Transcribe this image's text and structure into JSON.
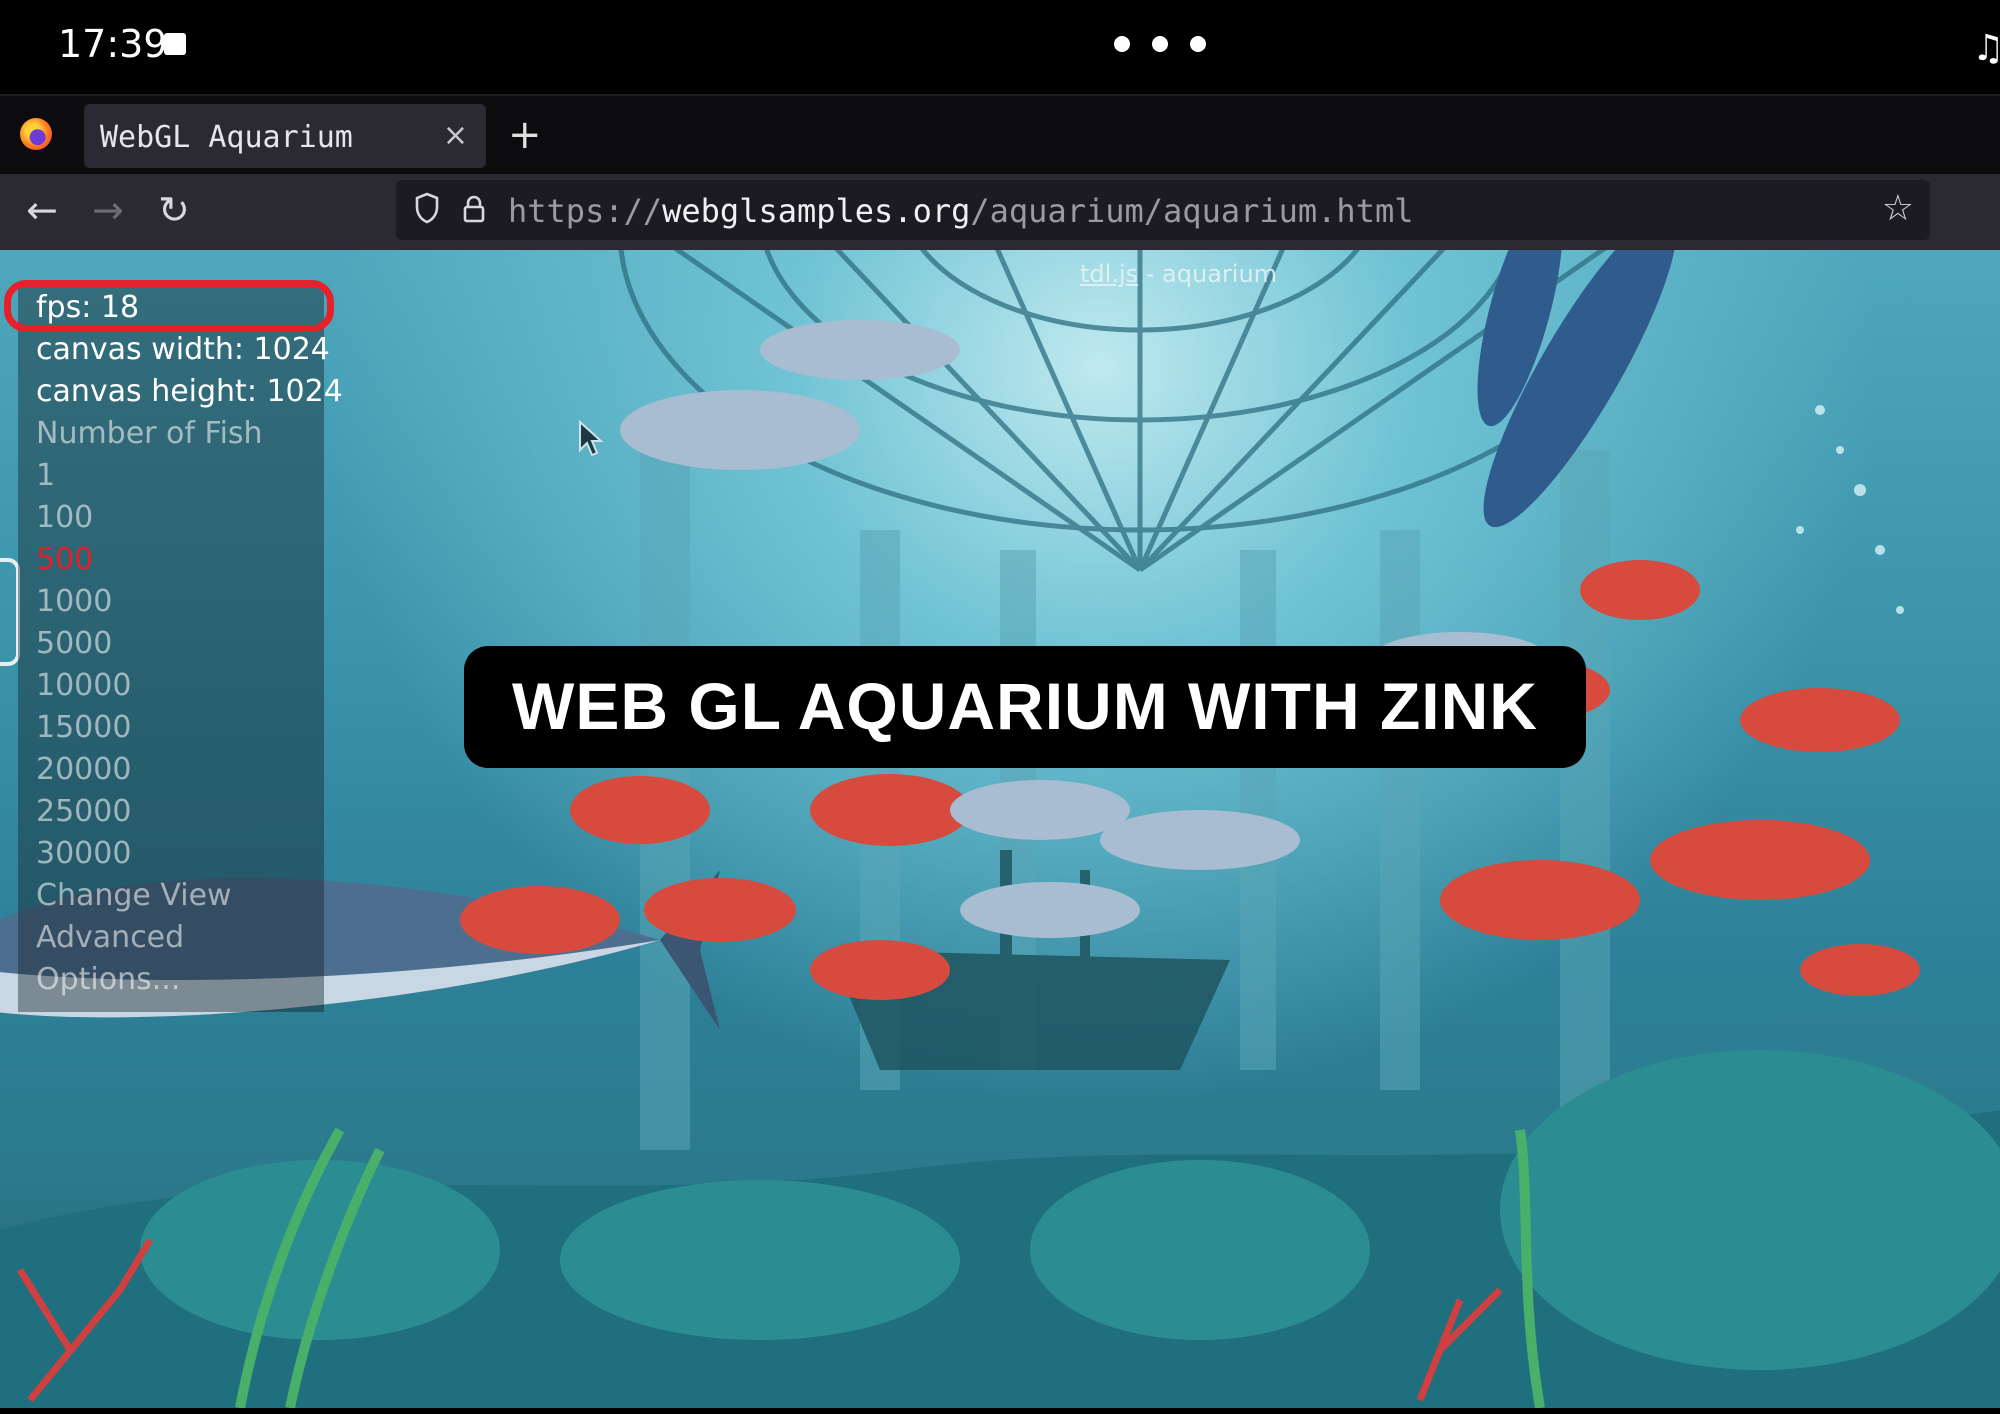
{
  "status_bar": {
    "time": "17:39"
  },
  "browser": {
    "tab": {
      "title": "WebGL Aquarium",
      "close_glyph": "×"
    },
    "new_tab_glyph": "+",
    "nav": {
      "back_glyph": "←",
      "forward_glyph": "→",
      "reload_glyph": "↻"
    },
    "url": {
      "scheme": "https://",
      "host": "webglsamples.org",
      "path": "/aquarium/aquarium.html"
    },
    "bookmark_glyph": "☆"
  },
  "page": {
    "credit_link": "tdl.js",
    "credit_rest": " - aquarium",
    "panel": {
      "fps": "fps: 18",
      "canvas_width": "canvas width: 1024",
      "canvas_height": "canvas height: 1024",
      "number_of_fish_label": "Number of Fish",
      "fish_options": [
        "1",
        "100",
        "500",
        "1000",
        "5000",
        "10000",
        "15000",
        "20000",
        "25000",
        "30000"
      ],
      "selected_fish_option": "500",
      "change_view": "Change View",
      "advanced": "Advanced",
      "options": "Options..."
    }
  },
  "overlay_caption": "WEB GL AQUARIUM WITH ZINK",
  "colors": {
    "highlight": "#e8202a",
    "selected": "#e0202a",
    "water": "#3b93aa"
  },
  "icons": {
    "browser_logo": "firefox-logo",
    "url_shield": "shield-icon",
    "url_lock": "lock-icon",
    "bookmark": "star-icon"
  }
}
